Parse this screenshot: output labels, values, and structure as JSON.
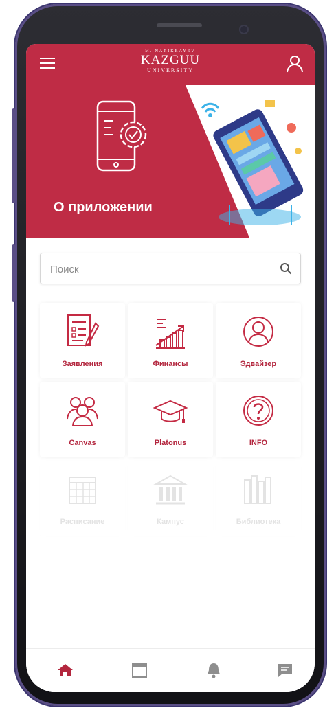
{
  "header": {
    "logo_small": "M. NARIKBAYEV",
    "logo_main": "KAZGUU",
    "logo_sub": "UNIVERSITY"
  },
  "banner": {
    "title": "О приложении"
  },
  "search": {
    "placeholder": "Поиск"
  },
  "tiles": [
    {
      "label": "Заявления",
      "icon": "document-list-icon"
    },
    {
      "label": "Финансы",
      "icon": "growth-chart-icon"
    },
    {
      "label": "Эдвайзер",
      "icon": "advisor-user-icon"
    },
    {
      "label": "Canvas",
      "icon": "users-group-icon"
    },
    {
      "label": "Platonus",
      "icon": "graduation-cap-icon"
    },
    {
      "label": "INFO",
      "icon": "question-circle-icon"
    },
    {
      "label": "Расписание",
      "icon": "calendar-grid-icon"
    },
    {
      "label": "Кампус",
      "icon": "building-icon"
    },
    {
      "label": "Библиотека",
      "icon": "books-icon"
    }
  ],
  "bottom_nav": [
    {
      "icon": "home-icon",
      "active": true
    },
    {
      "icon": "calendar-icon",
      "active": false
    },
    {
      "icon": "bell-icon",
      "active": false
    },
    {
      "icon": "chat-icon",
      "active": false
    }
  ],
  "colors": {
    "brand": "#bf2c45",
    "accent_text": "#b3263e",
    "inactive_icon": "#8e8e8e"
  }
}
